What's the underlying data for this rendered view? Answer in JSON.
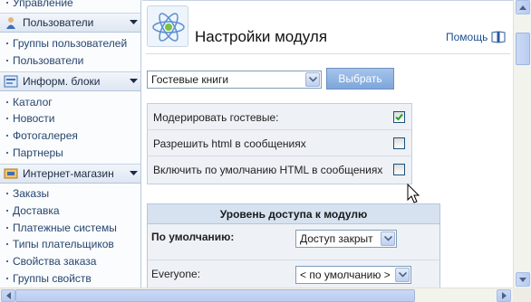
{
  "sidebar": {
    "top_item": "Управление",
    "sections": [
      {
        "label": "Пользователи",
        "icon": "users-icon",
        "items": [
          "Группы пользователей",
          "Пользователи"
        ]
      },
      {
        "label": "Информ. блоки",
        "icon": "info-blocks-icon",
        "items": [
          "Каталог",
          "Новости",
          "Фотогалерея",
          "Партнеры"
        ]
      },
      {
        "label": "Интернет-магазин",
        "icon": "shop-icon",
        "items": [
          "Заказы",
          "Доставка",
          "Платежные системы",
          "Типы плательщиков",
          "Свойства заказа",
          "Группы свойств"
        ]
      }
    ]
  },
  "header": {
    "title": "Настройки модуля",
    "help_label": "Помощь"
  },
  "module_select": {
    "value": "Гостевые книги",
    "button_label": "Выбрать"
  },
  "options": [
    {
      "label": "Модерировать гостевые:",
      "checked": true
    },
    {
      "label": "Разрешить html в сообщениях",
      "checked": false
    },
    {
      "label": "Включить по умолчанию HTML в сообщениях",
      "checked": false
    }
  ],
  "access": {
    "title": "Уровень доступа к модулю",
    "rows": [
      {
        "label": "По умолчанию:",
        "value": "Доступ закрыт"
      },
      {
        "label": "Everyone:",
        "value": "< по умолчанию >"
      }
    ]
  },
  "colors": {
    "button_bg": "#8fb3e2",
    "sidebar_header_bg": "#dde6f2",
    "table_bg": "#eef1f6",
    "access_header_bg": "#d7e2f1",
    "link": "#1d4f91"
  }
}
